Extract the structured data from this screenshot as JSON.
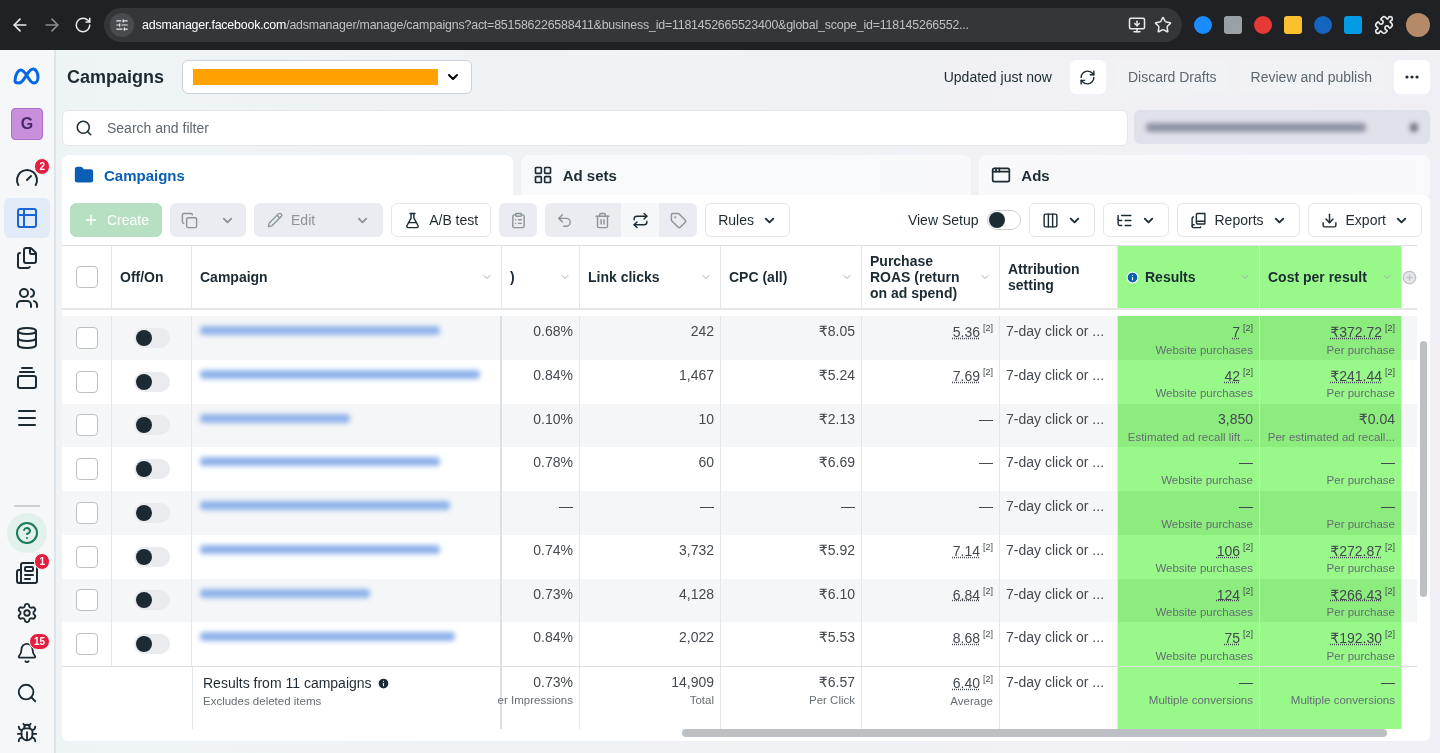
{
  "browser": {
    "url_host": "adsmanager.facebook.com",
    "url_path": "/adsmanager/manage/campaigns?act=851586226588411&business_id=1181452665523400&global_scope_id=118145266552..."
  },
  "sidebar": {
    "avatar": "G",
    "items": [
      {
        "kind": "gauge",
        "badge": "2",
        "selected": false
      },
      {
        "kind": "table",
        "selected": true
      },
      {
        "kind": "pages",
        "selected": false
      },
      {
        "kind": "people",
        "selected": false
      },
      {
        "kind": "database",
        "selected": false
      },
      {
        "kind": "media",
        "selected": false
      },
      {
        "kind": "menu",
        "selected": false
      }
    ],
    "bottom_items": [
      {
        "kind": "help"
      },
      {
        "kind": "news",
        "badge": "1"
      },
      {
        "kind": "settings"
      },
      {
        "kind": "bell",
        "badge": "15"
      },
      {
        "kind": "search"
      },
      {
        "kind": "bug"
      }
    ]
  },
  "header": {
    "title": "Campaigns",
    "status": "Updated just now",
    "buttons": [
      "Discard Drafts",
      "Review and publish"
    ]
  },
  "search": {
    "placeholder": "Search and filter"
  },
  "tabs": [
    {
      "label": "Campaigns",
      "kind": "campaigns",
      "selected": true
    },
    {
      "label": "Ad sets",
      "kind": "adsets",
      "selected": false
    },
    {
      "label": "Ads",
      "kind": "ads",
      "selected": false
    }
  ],
  "toolbar": {
    "create": {
      "label": "Create",
      "disabled": true
    },
    "edit": "Edit",
    "ab_test": "A/B test",
    "rules": "Rules",
    "view_setup": {
      "label": "View Setup",
      "on": false
    },
    "reports": "Reports",
    "export": "Export"
  },
  "table": {
    "all_selected": false,
    "fixed_columns": [
      {
        "label": "Off/On"
      },
      {
        "label": "Campaign"
      }
    ],
    "columns": [
      {
        "label": ")",
        "kind": "number",
        "highlighted": false
      },
      {
        "label": "Link clicks",
        "kind": "number",
        "highlighted": false
      },
      {
        "label": "CPC (all)",
        "kind": "number",
        "highlighted": false
      },
      {
        "label": "Purchase ROAS (return on ad spend)",
        "kind": "number",
        "highlighted": false
      },
      {
        "label": "Attribution setting",
        "kind": "text",
        "highlighted": false
      },
      {
        "label": "Results",
        "kind": "number",
        "highlighted": true,
        "info": true
      },
      {
        "label": "Cost per result",
        "kind": "number",
        "highlighted": true
      }
    ],
    "rows": [
      {
        "selected": false,
        "on": false,
        "cells": [
          {
            "value": "0.68%"
          },
          {
            "value": "242"
          },
          {
            "value": "₹8.05"
          },
          {
            "value": "5.36",
            "note": "[2]"
          },
          {
            "value": "7-day click or ..."
          },
          {
            "value": "7",
            "note": "[2]",
            "caption": "Website purchases"
          },
          {
            "value": "₹372.72",
            "note": "[2]",
            "caption": "Per purchase"
          }
        ]
      },
      {
        "selected": false,
        "on": false,
        "cells": [
          {
            "value": "0.84%"
          },
          {
            "value": "1,467"
          },
          {
            "value": "₹5.24"
          },
          {
            "value": "7.69",
            "note": "[2]"
          },
          {
            "value": "7-day click or ..."
          },
          {
            "value": "42",
            "note": "[2]",
            "caption": "Website purchases"
          },
          {
            "value": "₹241.44",
            "note": "[2]",
            "caption": "Per purchase"
          }
        ]
      },
      {
        "selected": false,
        "on": false,
        "cells": [
          {
            "value": "0.10%"
          },
          {
            "value": "10"
          },
          {
            "value": "₹2.13"
          },
          {
            "value": "—"
          },
          {
            "value": "7-day click or ..."
          },
          {
            "value": "3,850",
            "caption": "Estimated ad recall lift ..."
          },
          {
            "value": "₹0.04",
            "caption": "Per estimated ad recall..."
          }
        ]
      },
      {
        "selected": false,
        "on": false,
        "cells": [
          {
            "value": "0.78%"
          },
          {
            "value": "60"
          },
          {
            "value": "₹6.69"
          },
          {
            "value": "—"
          },
          {
            "value": "7-day click or ..."
          },
          {
            "value": "—",
            "caption": "Website purchase"
          },
          {
            "value": "—",
            "caption": "Per purchase"
          }
        ]
      },
      {
        "selected": false,
        "on": false,
        "cells": [
          {
            "value": "—"
          },
          {
            "value": "—"
          },
          {
            "value": "—"
          },
          {
            "value": "—"
          },
          {
            "value": "7-day click or ..."
          },
          {
            "value": "—",
            "caption": "Website purchase"
          },
          {
            "value": "—",
            "caption": "Per purchase"
          }
        ]
      },
      {
        "selected": false,
        "on": false,
        "cells": [
          {
            "value": "0.74%"
          },
          {
            "value": "3,732"
          },
          {
            "value": "₹5.92"
          },
          {
            "value": "7.14",
            "note": "[2]"
          },
          {
            "value": "7-day click or ..."
          },
          {
            "value": "106",
            "note": "[2]",
            "caption": "Website purchases"
          },
          {
            "value": "₹272.87",
            "note": "[2]",
            "caption": "Per purchase"
          }
        ]
      },
      {
        "selected": false,
        "on": false,
        "cells": [
          {
            "value": "0.73%"
          },
          {
            "value": "4,128"
          },
          {
            "value": "₹6.10"
          },
          {
            "value": "6.84",
            "note": "[2]"
          },
          {
            "value": "7-day click or ..."
          },
          {
            "value": "124",
            "note": "[2]",
            "caption": "Website purchases"
          },
          {
            "value": "₹266.43",
            "note": "[2]",
            "caption": "Per purchase"
          }
        ]
      },
      {
        "selected": false,
        "on": false,
        "cells": [
          {
            "value": "0.84%"
          },
          {
            "value": "2,022"
          },
          {
            "value": "₹5.53"
          },
          {
            "value": "8.68",
            "note": "[2]"
          },
          {
            "value": "7-day click or ..."
          },
          {
            "value": "75",
            "note": "[2]",
            "caption": "Website purchases"
          },
          {
            "value": "₹192.30",
            "note": "[2]",
            "caption": "Per purchase"
          }
        ]
      }
    ],
    "footer": {
      "title": "Results from 11 campaigns",
      "subtitle": "Excludes deleted items",
      "cells": [
        {
          "value": "0.73%",
          "caption": "er Impressions"
        },
        {
          "value": "14,909",
          "caption": "Total"
        },
        {
          "value": "₹6.57",
          "caption": "Per Click"
        },
        {
          "value": "6.40",
          "note": "[2]",
          "caption": "Average"
        },
        {
          "value": "7-day click or ..."
        },
        {
          "value": "—",
          "caption": "Multiple conversions"
        },
        {
          "value": "—",
          "caption": "Multiple conversions"
        }
      ]
    }
  }
}
